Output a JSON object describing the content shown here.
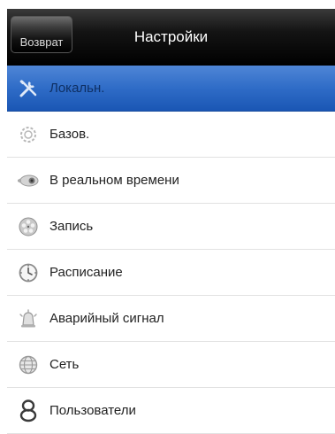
{
  "navbar": {
    "back_label": "Возврат",
    "title": "Настройки"
  },
  "menu": {
    "items": [
      {
        "label": "Локальн.",
        "icon": "tools-icon",
        "selected": true
      },
      {
        "label": "Базов.",
        "icon": "gear-icon",
        "selected": false
      },
      {
        "label": "В реальном времени",
        "icon": "camera-icon",
        "selected": false
      },
      {
        "label": "Запись",
        "icon": "film-reel-icon",
        "selected": false
      },
      {
        "label": "Расписание",
        "icon": "clock-icon",
        "selected": false
      },
      {
        "label": "Аварийный сигнал",
        "icon": "alarm-bell-icon",
        "selected": false
      },
      {
        "label": "Сеть",
        "icon": "globe-icon",
        "selected": false
      },
      {
        "label": "Пользователи",
        "icon": "users-icon",
        "selected": false
      }
    ]
  },
  "colors": {
    "selected_row": "#2f6cc7",
    "navbar": "#000000",
    "divider": "#e2e2e2"
  }
}
